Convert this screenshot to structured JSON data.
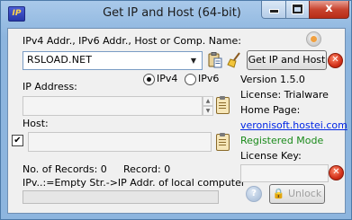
{
  "window": {
    "title": "Get IP and Host (64-bit)",
    "icon_text": "IP",
    "close_glyph": "x"
  },
  "form": {
    "query_label": "IPv4 Addr., IPv6 Addr., Host or Comp. Name:",
    "query_value": "RSLOAD.NET",
    "get_button": "Get IP and Host",
    "ipv4_label": "IPv4",
    "ipv6_label": "IPv6",
    "ip_version_selected": "IPv4",
    "ip_label": "IP Address:",
    "ip_value": "",
    "host_label": "Host:",
    "host_value": "",
    "host_checked": true,
    "records_label": "No. of Records: 0",
    "record_label": "Record: 0",
    "hint": "IPv..:=Empty Str.->IP Addr. of local computer",
    "progress": 0
  },
  "info": {
    "version": "Version 1.5.0",
    "license": "License: Trialware",
    "homepage_label": "Home Page:",
    "homepage_link": "veronisoft.hostei.com",
    "mode": "Registered Mode",
    "license_key_label": "License Key:",
    "license_key_value": "",
    "unlock_button": "Unlock"
  },
  "icons": {
    "about": "about-icon",
    "paste": "paste-icon",
    "clear": "broom-icon",
    "clear_red": "red-x-icon",
    "clipboard": "clipboard-icon",
    "help": "help-icon",
    "lock": "lock-icon"
  },
  "colors": {
    "link": "#0026e6",
    "registered": "#1a8a1a",
    "close_button": "#c8442f"
  }
}
